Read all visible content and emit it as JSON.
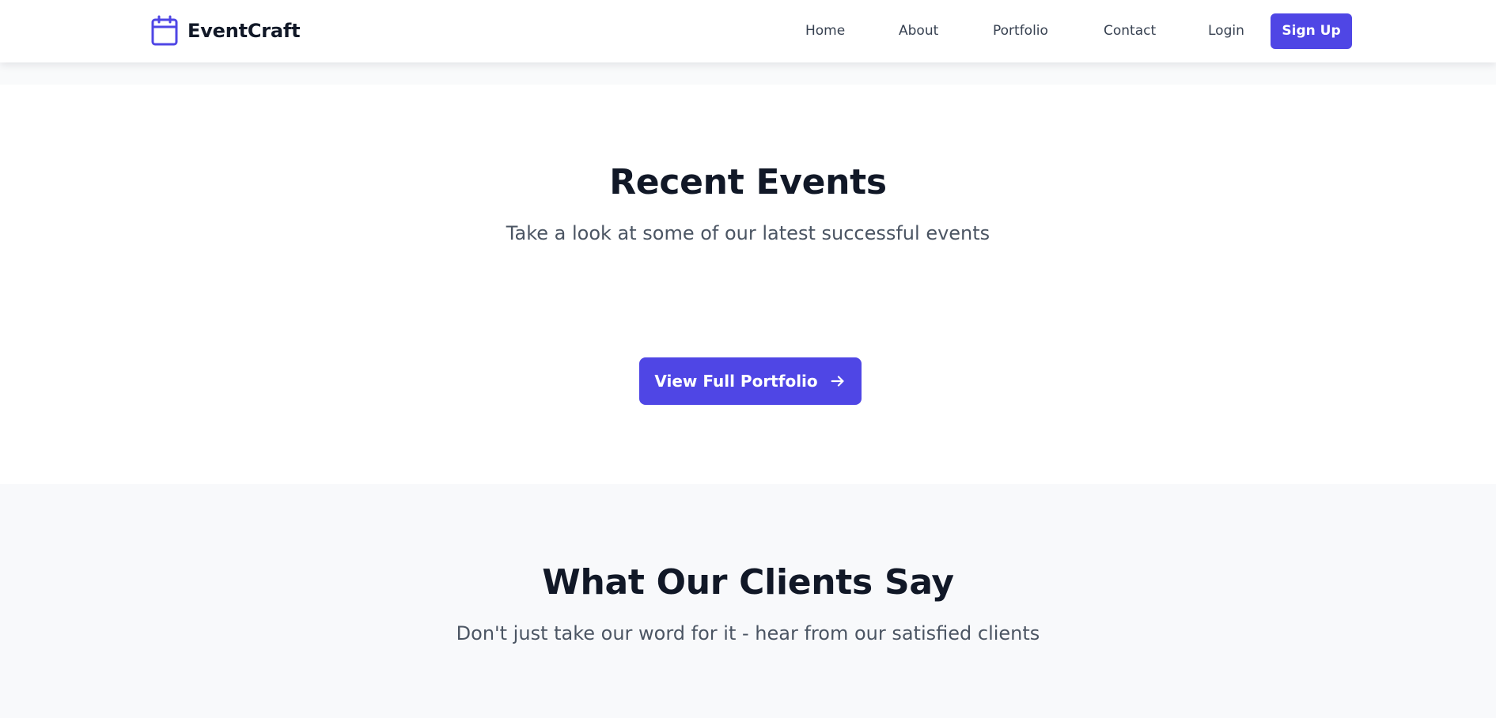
{
  "header": {
    "brand": {
      "name": "EventCraft",
      "icon": "calendar-icon"
    },
    "nav_links": [
      {
        "label": "Home"
      },
      {
        "label": "About"
      },
      {
        "label": "Portfolio"
      },
      {
        "label": "Contact"
      },
      {
        "label": "Login"
      }
    ],
    "signup_label": "Sign Up"
  },
  "recent_events": {
    "title": "Recent Events",
    "subtitle": "Take a look at some of our latest successful events",
    "cta_label": "View Full Portfolio",
    "cta_icon": "arrow-right-icon"
  },
  "testimonials": {
    "title": "What Our Clients Say",
    "subtitle": "Don't just take our word for it - hear from our satisfied clients"
  },
  "colors": {
    "accent": "#4f46e5",
    "heading": "#111827",
    "body_text": "#4b5563",
    "section_bg": "#f8f9fb"
  }
}
